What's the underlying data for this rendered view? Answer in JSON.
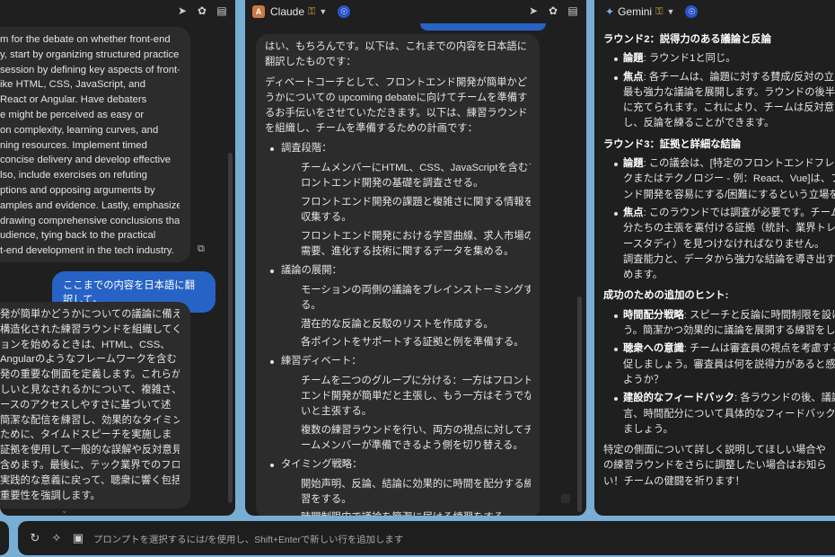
{
  "left_panel": {
    "bubble1_lines": [
      "m for the debate on whether front-end",
      "y, start by organizing structured practice",
      "session by defining key aspects of front-",
      "ike HTML, CSS, JavaScript, and",
      "React or Angular. Have debaters",
      "e might be perceived as easy or",
      "on complexity, learning curves, and",
      "ning resources. Implement timed",
      " concise delivery and develop effective",
      "lso, include exercises on refuting",
      "ptions and opposing arguments by",
      "amples and evidence. Lastly, emphasize",
      "drawing comprehensive conclusions that",
      "udience, tying back to the practical",
      "t-end development in the tech industry."
    ],
    "user_message": "ここまでの内容を日本語に翻訳して。",
    "bubble2_lines": [
      "発が簡単かどうかについての議論に備え",
      "構造化された練習ラウンドを組織してく",
      "ョンを始めるときは、HTML、CSS、",
      "Angularのようなフレームワークを含む",
      "発の重要な側面を定義します。これらが",
      "しいと見なされるかについて、複雑さ、",
      "ースのアクセスしやすさに基づいて述",
      "簡潔な配信を練習し、効果的なタイミン",
      "ために、タイムドスピーチを実施しま",
      "証拠を使用して一般的な誤解や反対意見",
      "含めます。最後に、テック業界でのフロ",
      "実践的な意義に戻って、聴衆に響く包括",
      "重要性を強調します。"
    ]
  },
  "claude_panel": {
    "title": "Claude",
    "intro": "はい、もちろんです。以下は、これまでの内容を日本語に翻訳したものです：",
    "paragraph_lines": [
      "ディベートコーチとして、フロントエンド開発が簡単かど",
      "うかについての upcoming debateに向けてチームを準備す",
      "るお手伝いをさせていただきます。以下は、練習ラウンド",
      "を組織し、チームを準備するための計画です："
    ],
    "sections": [
      {
        "title": "調査段階：",
        "items": [
          [
            "チームメンバーにHTML、CSS、JavaScriptを含むフ",
            "ロントエンド開発の基礎を調査させる。"
          ],
          [
            "フロントエンド開発の課題と複雑さに関する情報を",
            "収集する。"
          ],
          [
            "フロントエンド開発における学習曲線、求人市場の",
            "需要、進化する技術に関するデータを集める。"
          ]
        ]
      },
      {
        "title": "議論の展開：",
        "items": [
          [
            "モーションの両側の議論をブレインストーミングす",
            "る。"
          ],
          [
            "潜在的な反論と反駁のリストを作成する。"
          ],
          [
            "各ポイントをサポートする証拠と例を準備する。"
          ]
        ]
      },
      {
        "title": "練習ディベート：",
        "items": [
          [
            "チームを二つのグループに分ける：一方はフロント",
            "エンド開発が簡単だと主張し、もう一方はそうでな",
            "いと主張する。"
          ],
          [
            "複数の練習ラウンドを行い、両方の視点に対してチ",
            "ームメンバーが準備できるよう側を切り替える。"
          ]
        ]
      },
      {
        "title": "タイミング戦略：",
        "items": [
          [
            "開始声明、反論、結論に効果的に時間を配分する練",
            "習をする。"
          ],
          [
            "時間制限内で議論を簡潔に届ける練習をする。"
          ]
        ]
      }
    ]
  },
  "gemini_panel": {
    "title": "Gemini",
    "round2_title": "ラウンド2：説得力のある議論と反論",
    "round2_items": [
      {
        "label": "論題",
        "lines": [
          ": ラウンド1と同じ。"
        ]
      },
      {
        "label": "焦点",
        "lines": [
          ": 各チームは、論題に対する賛成/反対の立",
          "最も強力な議論を展開します。ラウンドの後半",
          "に充てられます。これにより、チームは反対意",
          "し、反論を練ることができます。"
        ]
      }
    ],
    "round3_title": "ラウンド3：証拠と詳細な結論",
    "round3_items": [
      {
        "label": "論題",
        "lines": [
          ": この議会は、[特定のフロントエンドフレー",
          "クまたはテクノロジー - 例：React、Vue]は、フ",
          "ンド開発を容易にする/困難にするという立場を"
        ]
      },
      {
        "label": "焦点",
        "lines": [
          ": このラウンドでは調査が必要です。チーム",
          "分たちの主張を裏付ける証拠（統計、業界トレ",
          "ースタディ）を見つけなければなりません。",
          "調査能力と、データから強力な結論を導き出す",
          "めます。"
        ]
      }
    ],
    "hints_title": "成功のための追加のヒント:",
    "hints": [
      {
        "label": "時間配分戦略",
        "lines": [
          ": スピーチと反論に時間制限を設け",
          "う。簡潔かつ効果的に議論を展開する練習をし"
        ]
      },
      {
        "label": "聴衆への意識",
        "lines": [
          ": チームは審査員の視点を考慮する",
          "促しましょう。審査員は何を説得力があると感",
          "ようか？"
        ]
      },
      {
        "label": "建設的なフィードバック",
        "lines": [
          ": 各ラウンドの後、議論",
          "言、時間配分について具体的なフィードバック",
          "ましょう。"
        ]
      }
    ],
    "closing_lines": [
      "特定の側面について詳しく説明してほしい場合や",
      "の練習ラウンドをさらに調整したい場合はお知ら",
      "い！チームの健闘を祈ります！"
    ]
  },
  "bottom_bar": {
    "placeholder": "プロンプトを選択するには/を使用し、Shift+Enterで新しい行を追加します"
  },
  "colors": {
    "accent": "#2763c4",
    "background": "#78aed4",
    "panel": "#1f1f1f"
  }
}
